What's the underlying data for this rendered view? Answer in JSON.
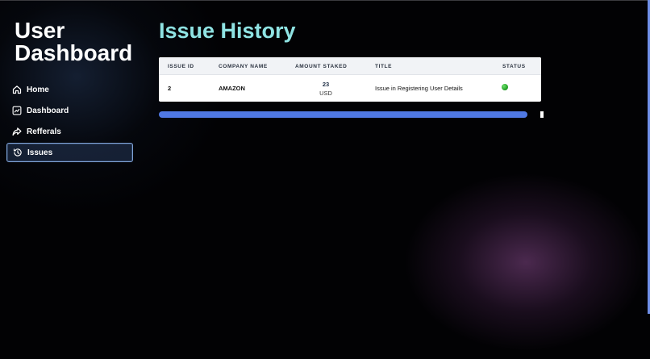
{
  "sidebar": {
    "brand_line1": "User",
    "brand_line2": "Dashboard",
    "items": [
      {
        "label": "Home",
        "icon": "home-icon"
      },
      {
        "label": "Dashboard",
        "icon": "chart-icon"
      },
      {
        "label": "Refferals",
        "icon": "share-icon"
      },
      {
        "label": "Issues",
        "icon": "history-icon",
        "active": true
      }
    ]
  },
  "main": {
    "title": "Issue History",
    "table": {
      "headers": [
        "ISSUE ID",
        "COMPANY NAME",
        "AMOUNT STAKED",
        "TITLE",
        "STATUS"
      ],
      "rows": [
        {
          "issue_id": "2",
          "company_name": "AMAZON",
          "amount": "23",
          "currency": "USD",
          "title": "Issue in Registering User Details",
          "status_color": "#2fb32f"
        }
      ]
    }
  },
  "colors": {
    "title": "#8fe3e3",
    "scroll_thumb": "#4f78e3",
    "active_border": "#7fa3d8"
  }
}
